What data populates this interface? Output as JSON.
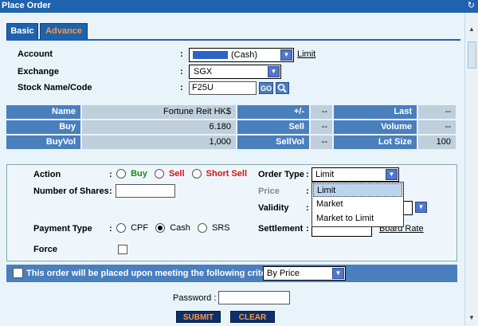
{
  "window": {
    "title": "Place Order"
  },
  "tabs": [
    {
      "label": "Basic"
    },
    {
      "label": "Advance"
    }
  ],
  "account": {
    "label": "Account",
    "value": "(Cash)",
    "limit_link": "Limit"
  },
  "exchange": {
    "label": "Exchange",
    "value": "SGX"
  },
  "stock": {
    "label": "Stock Name/Code",
    "value": "F25U",
    "go_label": "GO"
  },
  "info": {
    "name_label": "Name",
    "name_value": "Fortune Reit HK$",
    "change_label": "+/-",
    "change_value": "--",
    "last_label": "Last",
    "last_value": "--",
    "buy_label": "Buy",
    "buy_value": "6.180",
    "sell_label": "Sell",
    "sell_value": "--",
    "volume_label": "Volume",
    "volume_value": "--",
    "buyvol_label": "BuyVol",
    "buyvol_value": "1,000",
    "sellvol_label": "SellVol",
    "sellvol_value": "--",
    "lotsize_label": "Lot Size",
    "lotsize_value": "100"
  },
  "order": {
    "action_label": "Action",
    "action_options": [
      "Buy",
      "Sell",
      "Short Sell"
    ],
    "shares_label": "Number of Shares",
    "shares_value": "",
    "price_label": "Price",
    "validity_label": "Validity",
    "order_type_label": "Order Type",
    "order_type_value": "Limit",
    "order_type_options": [
      "Limit",
      "Market",
      "Market to Limit"
    ],
    "payment_label": "Payment Type",
    "payment_options": [
      "CPF",
      "Cash",
      "SRS"
    ],
    "payment_selected": "Cash",
    "settlement_label": "Settlement",
    "board_rate_link": "Board Rate",
    "force_label": "Force"
  },
  "criteria": {
    "text": "This order will be placed upon meeting the following criteria:",
    "value": "By Price"
  },
  "password": {
    "label": "Password",
    "value": ""
  },
  "buttons": {
    "submit": "SUBMIT",
    "clear": "CLEAR"
  },
  "colors": {
    "header_blue": "#1f62ae",
    "accent_orange": "#ff9a3c",
    "buy_green": "#1a8a1a",
    "sell_red": "#d41111"
  },
  "icons": [
    "refresh-icon",
    "search-icon",
    "chevron-down-icon"
  ]
}
